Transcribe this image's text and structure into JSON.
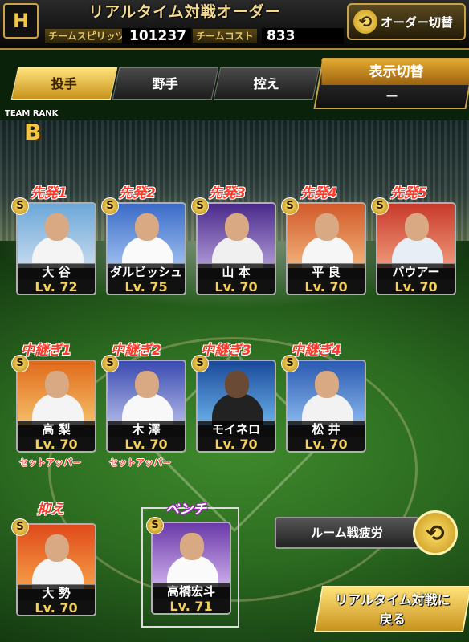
{
  "header": {
    "logo": "H",
    "title": "リアルタイム対戦オーダー",
    "team_spirits_label": "チームスピリッツ",
    "team_spirits_value": "101237",
    "team_cost_label": "チームコスト",
    "team_cost_value": "833",
    "order_switch_label": "オーダー切替"
  },
  "tabs": [
    {
      "label": "投手",
      "active": true
    },
    {
      "label": "野手",
      "active": false
    },
    {
      "label": "控え",
      "active": false
    }
  ],
  "display_toggle": {
    "label": "表示切替",
    "value": "ー"
  },
  "team_rank": {
    "label": "TEAM RANK",
    "value": "B"
  },
  "starters": [
    {
      "role": "先発1",
      "name": "大 谷",
      "level": "Lv. 72"
    },
    {
      "role": "先発2",
      "name": "ダルビッシュ",
      "level": "Lv. 75"
    },
    {
      "role": "先発3",
      "name": "山 本",
      "level": "Lv. 70"
    },
    {
      "role": "先発4",
      "name": "平 良",
      "level": "Lv. 70"
    },
    {
      "role": "先発5",
      "name": "バウアー",
      "level": "Lv. 70"
    }
  ],
  "relievers": [
    {
      "role": "中継ぎ1",
      "name": "高 梨",
      "level": "Lv. 70",
      "sub": "セットアッパー"
    },
    {
      "role": "中継ぎ2",
      "name": "木 澤",
      "level": "Lv. 70",
      "sub": "セットアッパー"
    },
    {
      "role": "中継ぎ3",
      "name": "モイネロ",
      "level": "Lv. 70",
      "sub": ""
    },
    {
      "role": "中継ぎ4",
      "name": "松 井",
      "level": "Lv. 70",
      "sub": ""
    }
  ],
  "closer": {
    "role": "抑え",
    "name": "大 勢",
    "level": "Lv. 70"
  },
  "bench": {
    "role": "ベンチ",
    "name": "高橋宏斗",
    "level": "Lv. 71"
  },
  "room_fatigue_label": "ルーム戦疲労",
  "return_button": {
    "line1": "リアルタイム対戦に",
    "line2": "戻る"
  },
  "colors": {
    "accent_gold": "#c9a24a",
    "role_red": "#ff3a2a",
    "level_yellow": "#f2d15a"
  }
}
